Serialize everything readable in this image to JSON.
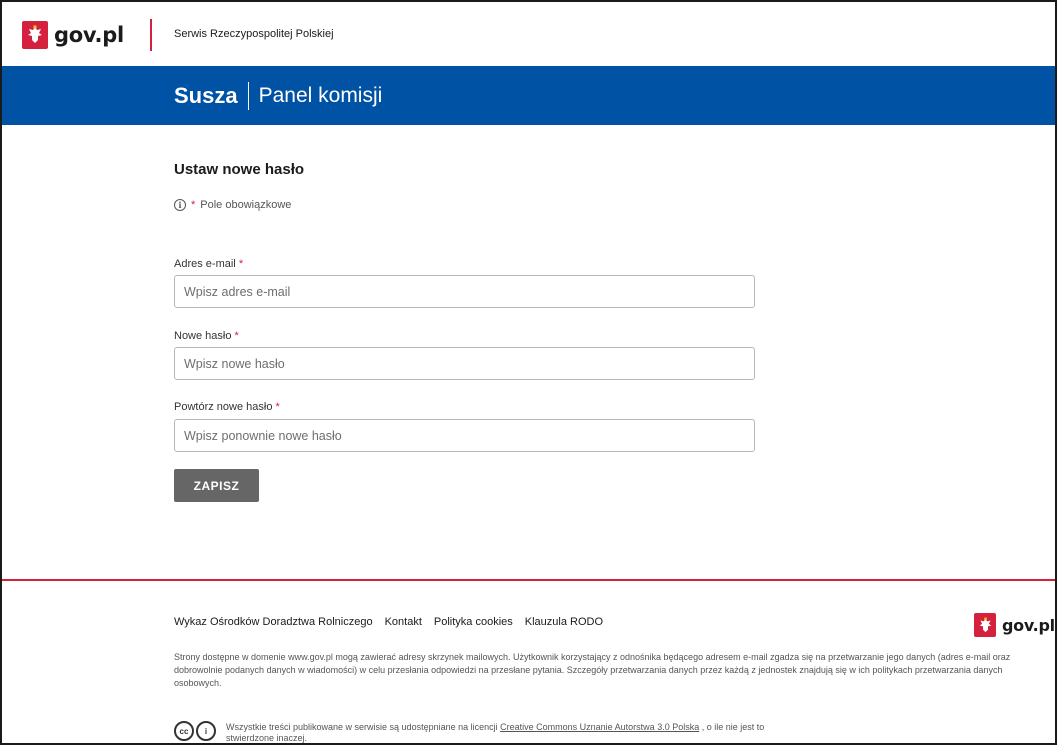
{
  "header": {
    "logo_text": "gov.pl",
    "service_name": "Serwis Rzeczypospolitej Polskiej"
  },
  "band": {
    "title": "Susza",
    "subtitle": "Panel komisji"
  },
  "form": {
    "title": "Ustaw nowe hasło",
    "required_star": "*",
    "required_note": "Pole obowiązkowe",
    "fields": [
      {
        "label": "Adres e-mail",
        "placeholder": "Wpisz adres e-mail",
        "value": ""
      },
      {
        "label": "Nowe hasło",
        "placeholder": "Wpisz nowe hasło",
        "value": ""
      },
      {
        "label": "Powtórz nowe hasło",
        "placeholder": "Wpisz ponownie nowe hasło",
        "value": ""
      }
    ],
    "submit_label": "ZAPISZ"
  },
  "footer": {
    "links": [
      "Wykaz Ośrodków Doradztwa Rolniczego",
      "Kontakt",
      "Polityka cookies",
      "Klauzula RODO"
    ],
    "logo_text": "gov.pl",
    "privacy_text": "Strony dostępne w domenie www.gov.pl mogą zawierać adresy skrzynek mailowych. Użytkownik korzystający z odnośnika będącego adresem e-mail zgadza się na przetwarzanie jego danych (adres e-mail oraz dobrowolnie podanych danych w wiadomości) w celu przesłania odpowiedzi na przesłane pytania. Szczegóły przetwarzania danych przez każdą z jednostek znajdują się w ich politykach przetwarzania danych osobowych.",
    "license_prefix": "Wszystkie treści publikowane w serwisie są udostępniane na licencji ",
    "license_link": "Creative Commons Uznanie Autorstwa 3.0 Polska",
    "license_suffix": " , o ile nie jest to stwierdzone inaczej.",
    "cc_icon_text": "cc",
    "by_icon_text": "i"
  },
  "colors": {
    "brand_blue": "#0052a5",
    "accent_red": "#d4213d",
    "button_gray": "#666666"
  }
}
